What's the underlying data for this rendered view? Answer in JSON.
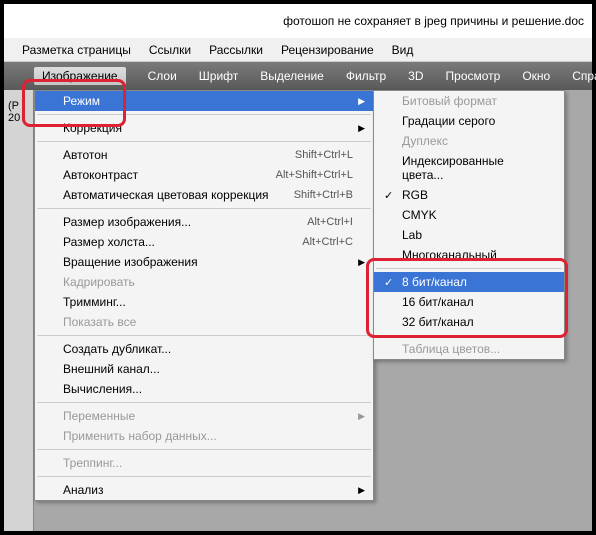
{
  "title": "фотошоп не сохраняет в jpeg причины и решение.doc",
  "menubar": [
    "Разметка страницы",
    "Ссылки",
    "Рассылки",
    "Рецензирование",
    "Вид"
  ],
  "toolbar": [
    "Изображение",
    "Слои",
    "Шрифт",
    "Выделение",
    "Фильтр",
    "3D",
    "Просмотр",
    "Окно",
    "Справка"
  ],
  "sidebar": {
    "line1": "(P",
    "line2": "20"
  },
  "main_menu": {
    "rezhim": "Режим",
    "korrektsiya": "Коррекция",
    "avtoton": {
      "label": "Автотон",
      "shortcut": "Shift+Ctrl+L"
    },
    "avtokontrast": {
      "label": "Автоконтраст",
      "shortcut": "Alt+Shift+Ctrl+L"
    },
    "avtotsvet": {
      "label": "Автоматическая цветовая коррекция",
      "shortcut": "Shift+Ctrl+B"
    },
    "razmer_izo": {
      "label": "Размер изображения...",
      "shortcut": "Alt+Ctrl+I"
    },
    "razmer_holsta": {
      "label": "Размер холста...",
      "shortcut": "Alt+Ctrl+C"
    },
    "vrashchenie": "Вращение изображения",
    "kadrirovat": "Кадрировать",
    "trimming": "Тримминг...",
    "pokazat_vse": "Показать все",
    "dublikat": "Создать дубликат...",
    "vneshniy": "Внешний канал...",
    "vychisleniya": "Вычисления...",
    "peremennye": "Переменные",
    "primenit": "Применить набор данных...",
    "trepping": "Треппинг...",
    "analiz": "Анализ"
  },
  "sub_menu": {
    "bitovyy": "Битовый формат",
    "gradatsii": "Градации серого",
    "dupleks": "Дуплекс",
    "indeksir": "Индексированные цвета...",
    "rgb": "RGB",
    "cmyk": "CMYK",
    "lab": "Lab",
    "mnogokanal": "Многоканальный",
    "bit8": "8 бит/канал",
    "bit16": "16 бит/канал",
    "bit32": "32 бит/канал",
    "tablitsa": "Таблица цветов..."
  }
}
